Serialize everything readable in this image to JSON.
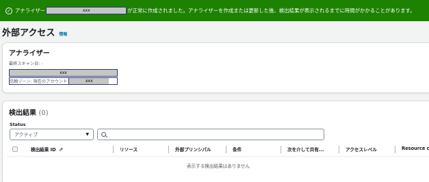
{
  "flash": {
    "check_icon": "check-circle-icon",
    "prefix": "アナライザー",
    "masked_name": "xxx",
    "message": "が正常に作成されました。アナライザーを作成または更新した後、検出結果が表示されるまでに時間がかかることがあります。"
  },
  "header": {
    "title": "外部アクセス",
    "info_link": "情報"
  },
  "analyzer": {
    "heading": "アナライザー",
    "last_scan": "最終スキャン日: -",
    "masked_name": "xxx",
    "trust_zone_label": "信頼ゾーン: 現在のアカウント",
    "trust_zone_masked": "xxx"
  },
  "findings": {
    "heading": "検出結果",
    "count": "(0)",
    "status_label": "Status",
    "status_value": "アクティブ",
    "search_placeholder": "",
    "columns": [
      "検出結果 ID",
      "リソース",
      "外部プリンシパル",
      "条件",
      "次を介して共有...",
      "アクセスレベル",
      "Resource con"
    ],
    "empty_message": "表示する検出結果はありません"
  },
  "colors": {
    "flash_bg": "#1d8102",
    "link": "#0073bb"
  }
}
